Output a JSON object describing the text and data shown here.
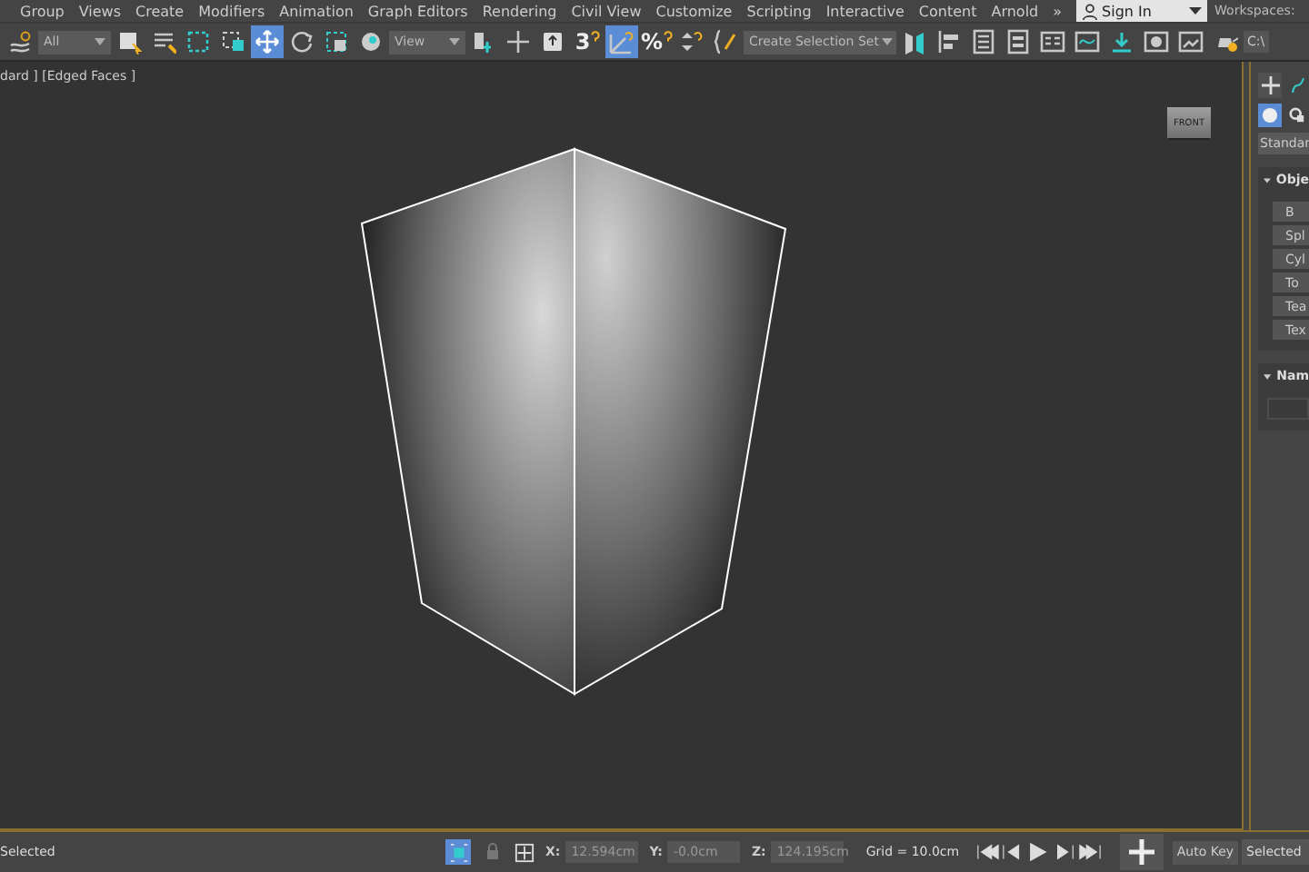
{
  "menu_bar": {
    "items": [
      "Group",
      "Views",
      "Create",
      "Modifiers",
      "Animation",
      "Graph Editors",
      "Rendering",
      "Civil View",
      "Customize",
      "Scripting",
      "Interactive",
      "Content",
      "Arnold",
      "»"
    ],
    "sign_in": "Sign In",
    "workspaces_label": "Workspaces:"
  },
  "toolbar": {
    "items": [
      {
        "kind": "tool",
        "selected": false
      },
      {
        "kind": "dropdown",
        "text": "All"
      },
      {
        "kind": "tool",
        "selected": false
      },
      {
        "kind": "tool",
        "selected": false
      },
      {
        "kind": "tool",
        "selected": false
      },
      {
        "kind": "tool",
        "selected": false
      },
      {
        "kind": "tool",
        "selected": true
      },
      {
        "kind": "tool",
        "selected": false
      },
      {
        "kind": "tool",
        "selected": false
      },
      {
        "kind": "tool",
        "selected": false
      },
      {
        "kind": "dropdown",
        "text": "View"
      },
      {
        "kind": "tool",
        "selected": false
      },
      {
        "kind": "tool",
        "selected": false
      },
      {
        "kind": "tool",
        "selected": false
      },
      {
        "kind": "tool",
        "selected": false,
        "glyph": "3"
      },
      {
        "kind": "tool",
        "selected": true
      },
      {
        "kind": "tool",
        "selected": false,
        "glyph": "%"
      },
      {
        "kind": "tool",
        "selected": false
      },
      {
        "kind": "tool",
        "selected": false
      },
      {
        "kind": "dropdown",
        "text": "Create Selection Set"
      },
      {
        "kind": "tool",
        "selected": false
      },
      {
        "kind": "tool",
        "selected": false
      },
      {
        "kind": "tool",
        "selected": false
      },
      {
        "kind": "tool",
        "selected": false
      },
      {
        "kind": "tool",
        "selected": false
      },
      {
        "kind": "tool",
        "selected": false
      },
      {
        "kind": "tool",
        "selected": false
      },
      {
        "kind": "tool",
        "selected": false
      },
      {
        "kind": "tool",
        "selected": false
      },
      {
        "kind": "tool",
        "selected": false
      },
      {
        "kind": "field",
        "text": "C:\\"
      }
    ]
  },
  "viewport": {
    "label": "dard ] [Edged Faces ]",
    "viewcube_face": "FRONT"
  },
  "command_panel": {
    "tabs": [
      {
        "selected": true
      },
      {
        "selected": false
      }
    ],
    "categories": [
      {
        "selected": true
      },
      {
        "selected": false
      }
    ],
    "type_dropdown": "Standar",
    "rollouts": [
      {
        "title": "Obje",
        "expanded": true,
        "buttons": [
          "B",
          "Spl",
          "Cyl",
          "To",
          "Tea",
          "Tex"
        ]
      },
      {
        "title": "Nam",
        "expanded": true
      }
    ]
  },
  "status_bar": {
    "selection": "Selected",
    "isolate_selected": true,
    "coords": [
      {
        "label": "X:",
        "value": "12.594cm"
      },
      {
        "label": "Y:",
        "value": "-0.0cm"
      },
      {
        "label": "Z:",
        "value": "124.195cm"
      }
    ],
    "grid": "Grid = 10.0cm",
    "auto_key": "Auto Key",
    "key_filter": "Selected"
  }
}
